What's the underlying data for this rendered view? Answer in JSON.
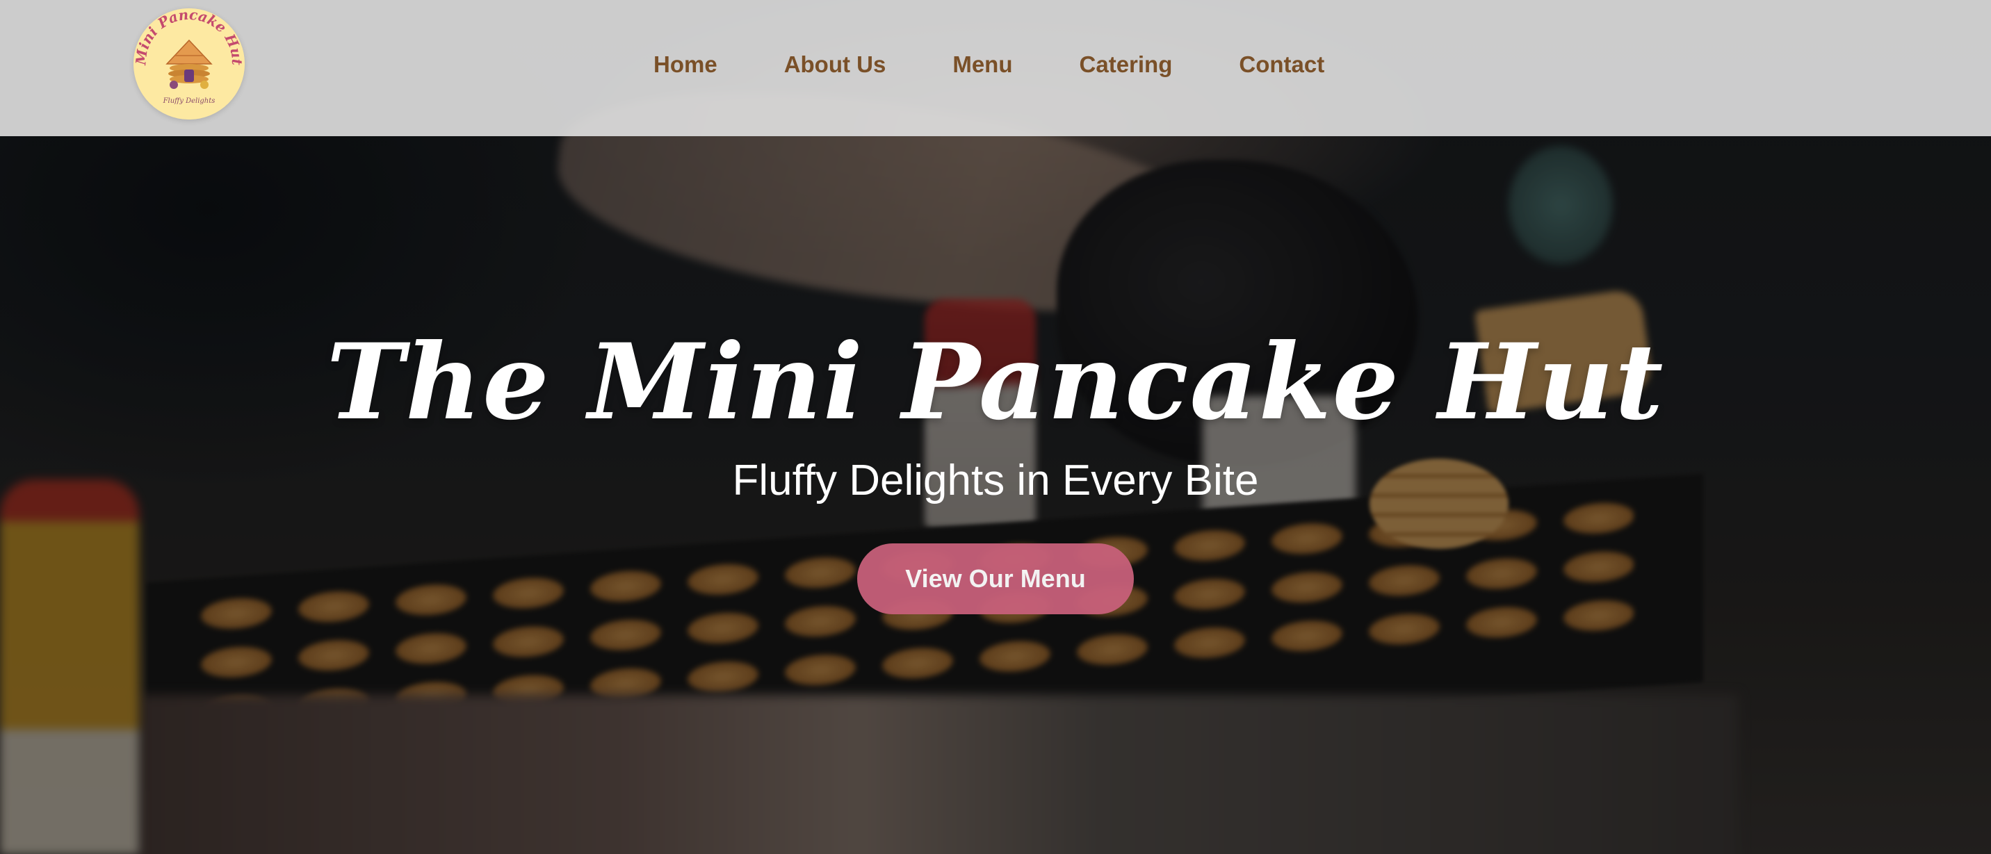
{
  "brand": {
    "logo_text": "Mini Pancake Hut",
    "logo_tagline": "Fluffy Delights",
    "colors": {
      "nav_text": "#7a5028",
      "cta_background": "#c7607a",
      "logo_background": "#fde9a2",
      "header_background": "#e1e1e1"
    }
  },
  "nav": {
    "items": [
      {
        "label": "Home"
      },
      {
        "label": "About Us"
      },
      {
        "label": "Menu"
      },
      {
        "label": "Catering"
      },
      {
        "label": "Contact"
      }
    ]
  },
  "hero": {
    "title": "The Mini Pancake Hut",
    "subtitle": "Fluffy Delights in Every Bite",
    "cta_label": "View Our Menu",
    "background": "blurred photo of mini pancakes cooking on a griddle"
  }
}
